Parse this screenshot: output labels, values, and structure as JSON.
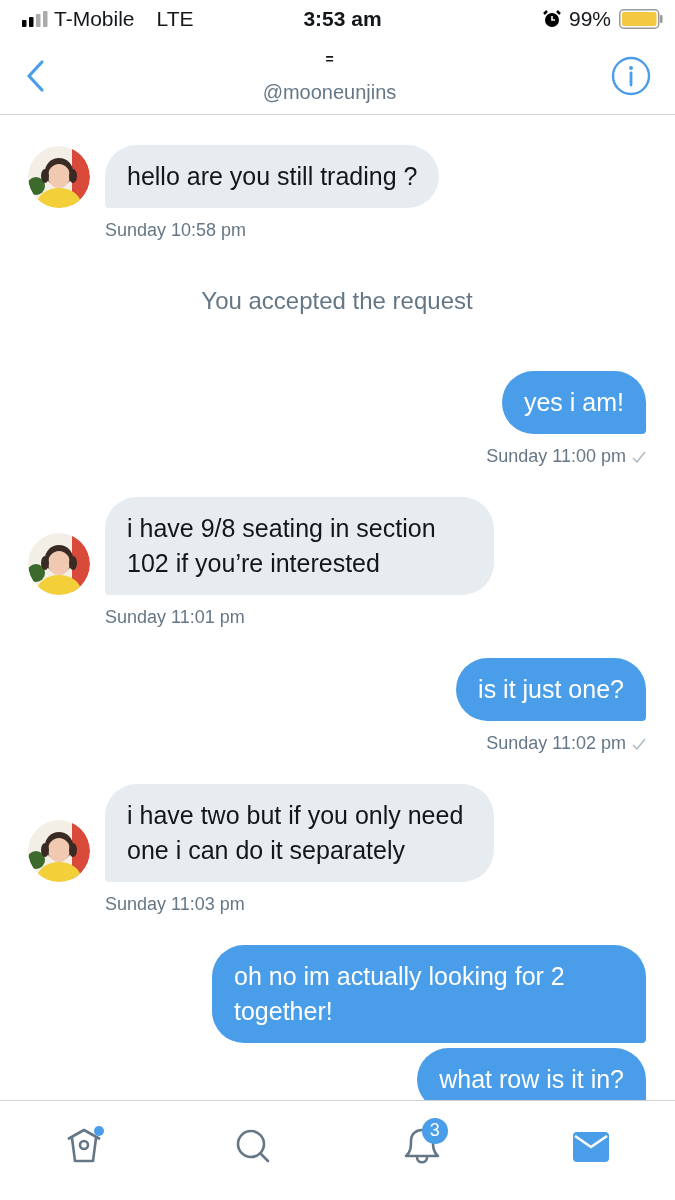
{
  "status_bar": {
    "carrier": "T-Mobile",
    "network": "LTE",
    "time": "3:53 am",
    "battery": "99%"
  },
  "header": {
    "name": "=",
    "handle": "@mooneunjins"
  },
  "messages": [
    {
      "kind": "incoming",
      "text": "hello are you still trading ?",
      "time": "Sunday 10:58 pm"
    },
    {
      "kind": "system",
      "text": "You accepted the request"
    },
    {
      "kind": "outgoing",
      "text": "yes i am!",
      "time": "Sunday 11:00 pm",
      "read": true
    },
    {
      "kind": "incoming",
      "text": "i have 9/8 seating in section 102 if you’re interested",
      "time": "Sunday 11:01 pm"
    },
    {
      "kind": "outgoing",
      "text": "is it just one?",
      "time": "Sunday 11:02 pm",
      "read": true
    },
    {
      "kind": "incoming",
      "text": "i have two but if you only need one i can do it separately",
      "time": "Sunday 11:03 pm"
    },
    {
      "kind": "outgoing",
      "text": "oh no im actually looking for 2 together!"
    },
    {
      "kind": "outgoing",
      "text": "what row is it in?"
    }
  ],
  "tabs": [
    {
      "kind": "home",
      "selected": false,
      "dot": true
    },
    {
      "kind": "search",
      "selected": false
    },
    {
      "kind": "notifications",
      "selected": false,
      "badge": "3"
    },
    {
      "kind": "messages",
      "selected": true
    }
  ]
}
